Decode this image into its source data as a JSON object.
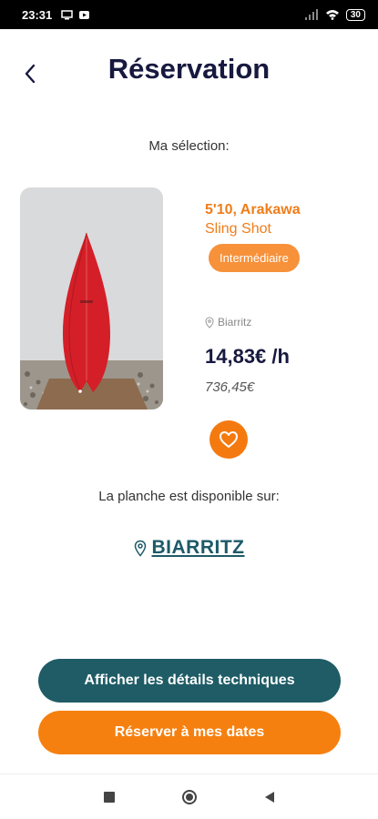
{
  "status_bar": {
    "time": "23:31",
    "battery": "30"
  },
  "header": {
    "title": "Réservation"
  },
  "selection": {
    "label": "Ma sélection:"
  },
  "board": {
    "name": "5'10, Arakawa",
    "brand": "Sling Shot",
    "level": "Intermédiaire",
    "location": "Biarritz",
    "price": "14,83€ /h",
    "total": "736,45€"
  },
  "availability": {
    "label": "La planche est disponible sur:",
    "city": "BIARRITZ"
  },
  "actions": {
    "details_label": "Afficher les détails techniques",
    "reserve_label": "Réserver à mes dates"
  },
  "colors": {
    "accent_orange": "#f6800f",
    "teal": "#1f5c66",
    "navy": "#17193f",
    "board_red": "#d41f28"
  },
  "icons": [
    "back-arrow-icon",
    "pin-icon",
    "heart-icon",
    "square-icon",
    "circle-icon",
    "triangle-back-icon"
  ]
}
